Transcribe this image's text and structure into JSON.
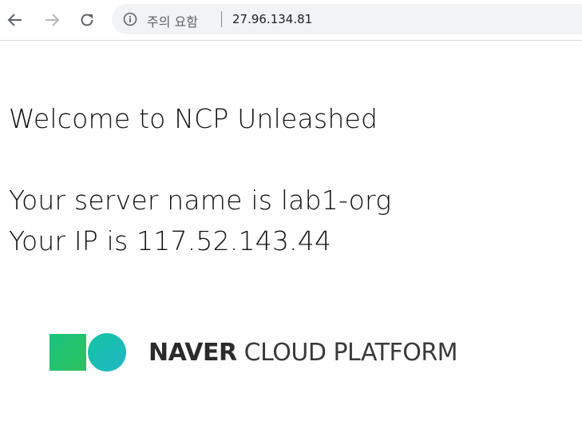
{
  "browser": {
    "back_icon": "arrow-left-icon",
    "forward_icon": "arrow-right-icon",
    "reload_icon": "reload-icon",
    "info_icon": "info-circle-icon",
    "security_label": "주의 요함",
    "url": "27.96.134.81"
  },
  "page": {
    "welcome": "Welcome to NCP Unleashed",
    "server_name_line": "Your server name is lab1-org",
    "ip_line": "Your IP is 117.52.143.44"
  },
  "logo": {
    "strong": "NAVER",
    "rest": "CLOUD PLATFORM",
    "square_color": "#1fc47a",
    "circle_color": "#17bdb5"
  }
}
